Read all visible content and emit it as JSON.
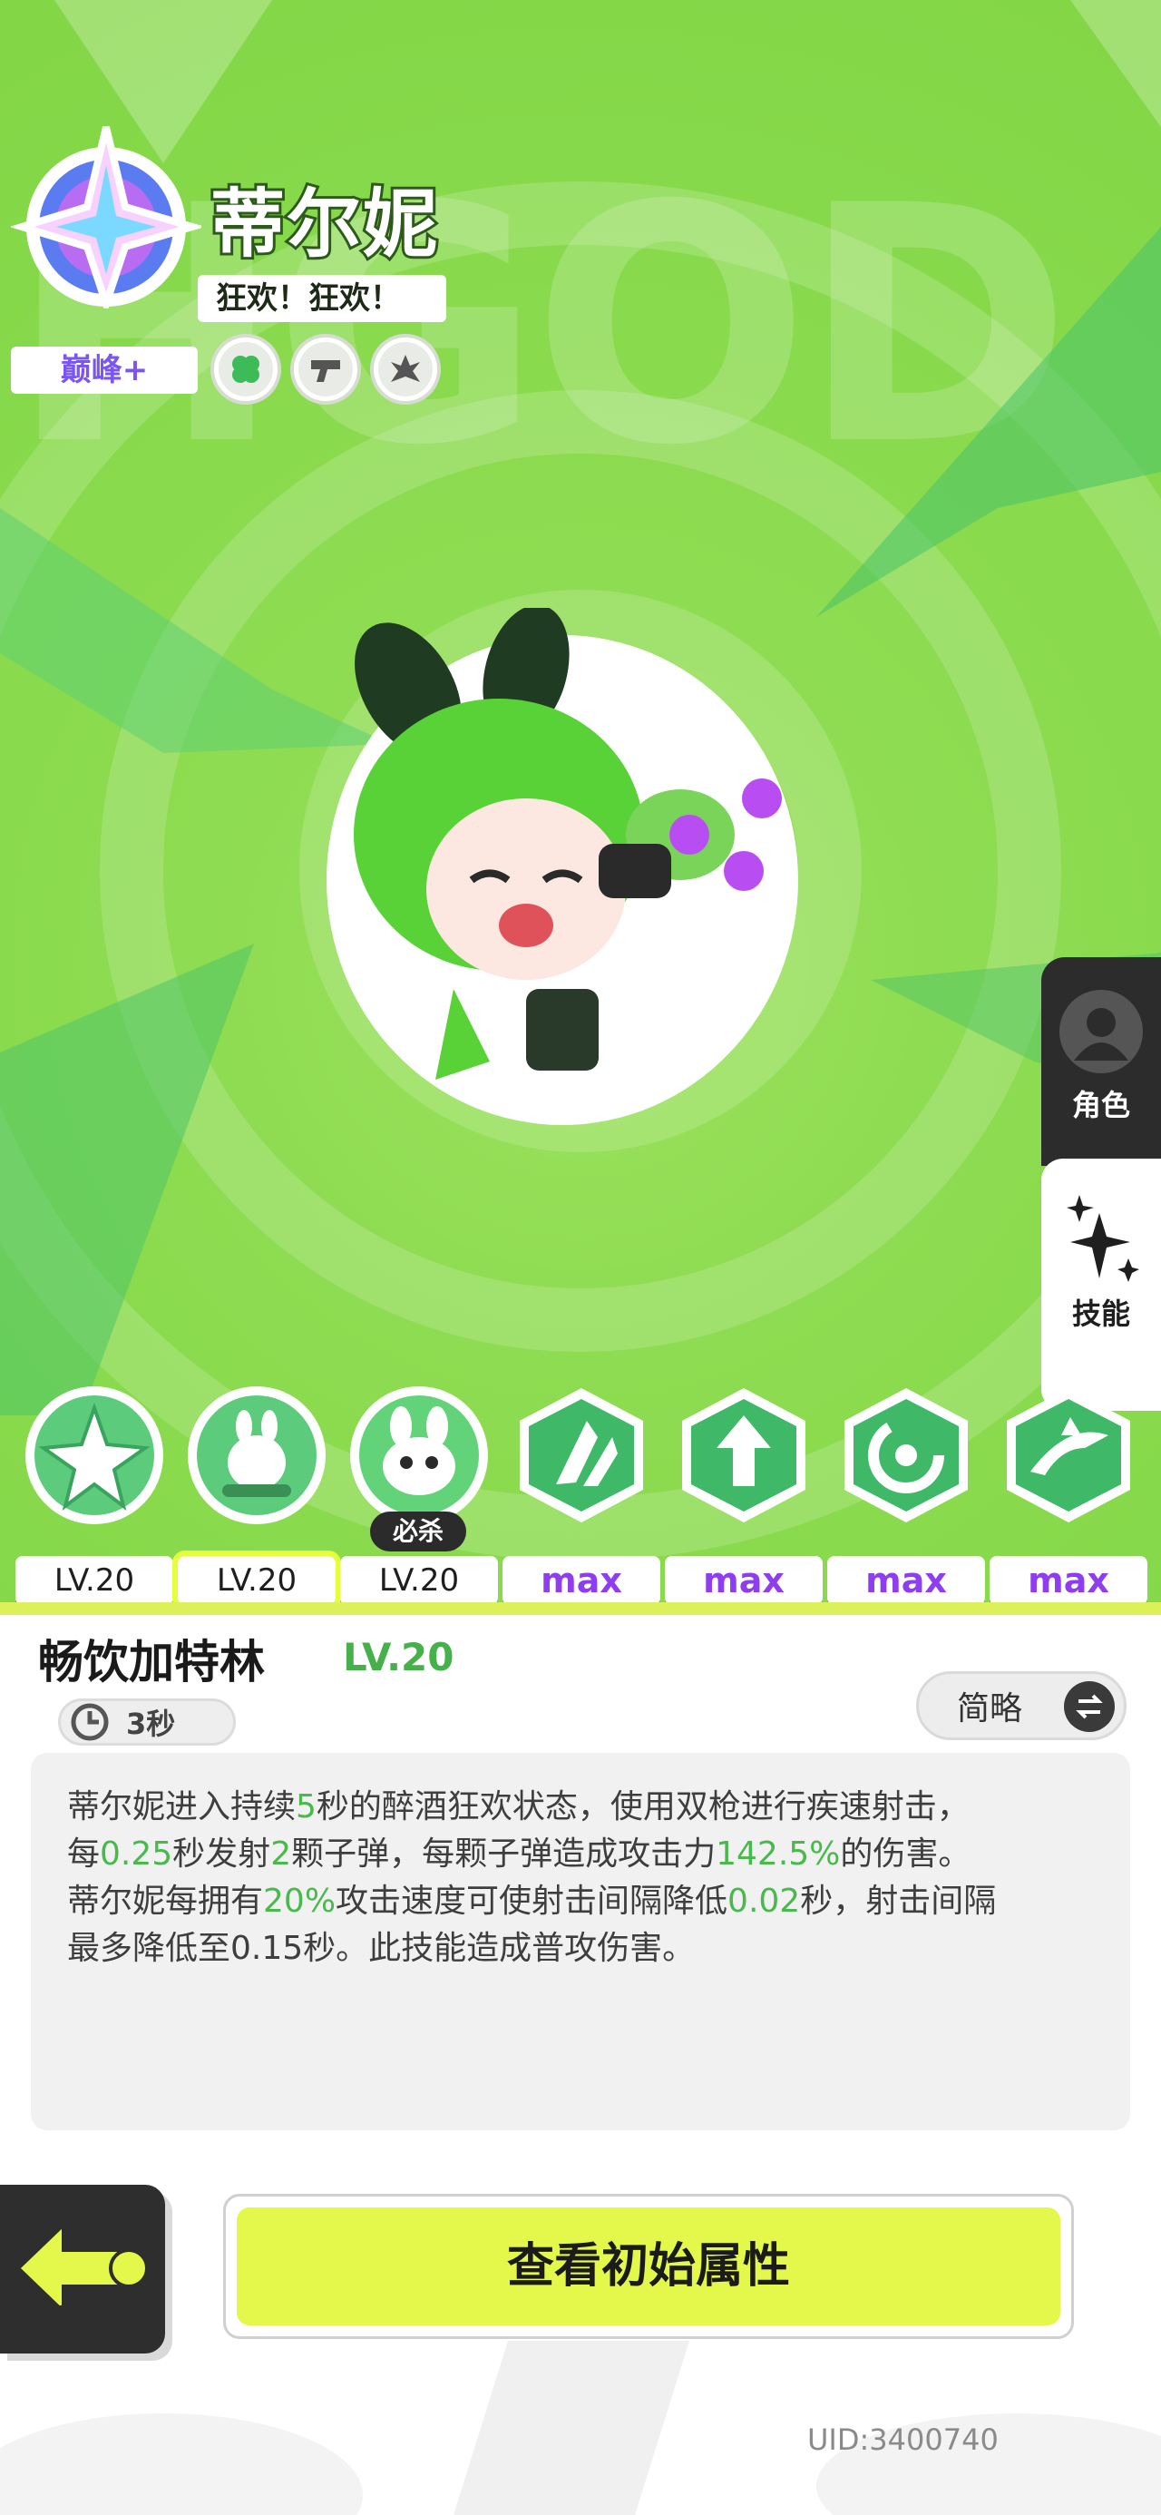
{
  "character": {
    "name": "蒂尔妮",
    "title": "狂欢！狂欢！",
    "rank": "巅峰+",
    "tags": [
      {
        "icon": "clover-icon"
      },
      {
        "icon": "pistol-icon"
      },
      {
        "icon": "burst-icon"
      }
    ]
  },
  "background_text": "HGOD",
  "side_tabs": [
    {
      "label": "角色",
      "icon": "person-icon",
      "active": false
    },
    {
      "label": "技能",
      "icon": "sparkle-icon",
      "active": true
    }
  ],
  "skills": [
    {
      "level": "LV.20",
      "icon": "star-burst-skill-icon"
    },
    {
      "level": "LV.20",
      "icon": "bunny-bottle-skill-icon",
      "selected": true
    },
    {
      "level": "LV.20",
      "icon": "bunny-ultimate-skill-icon",
      "tag": "必杀"
    },
    {
      "level": "max",
      "icon": "claw-slash-skill-icon"
    },
    {
      "level": "max",
      "icon": "arrow-up-skill-icon"
    },
    {
      "level": "max",
      "icon": "swirl-skill-icon"
    },
    {
      "level": "max",
      "icon": "dash-swirl-skill-icon"
    }
  ],
  "detail": {
    "skill_name": "畅饮加特林",
    "skill_level": "LV.20",
    "cooldown": "3秒",
    "toggle_label": "简略",
    "description": {
      "p1_a": "蒂尔妮进入持续",
      "p1_v1": "5",
      "p1_b": "秒的醉酒狂欢状态，使用双枪进行疾速射击，",
      "p2_a": "每",
      "p2_v1": "0.25",
      "p2_b": "秒发射",
      "p2_v2": "2",
      "p2_c": "颗子弹，每颗子弹造成攻击力",
      "p2_v3": "142.5%",
      "p2_d": "的伤害。",
      "p3_a": "蒂尔妮每拥有",
      "p3_v1": "20%",
      "p3_b": "攻击速度可使射击间隔降低",
      "p3_v2": "0.02",
      "p3_c": "秒，射击间隔",
      "p4": "最多降低至0.15秒。此技能造成普攻伤害。"
    }
  },
  "back_label": "BACK",
  "attr_button_label": "查看初始属性",
  "uid": "UID:3400740",
  "colors": {
    "accent_green": "#49b94d",
    "button_yellow": "#e3f84a",
    "max_purple": "#8e3ef0",
    "rank_purple": "#7a55f2"
  }
}
